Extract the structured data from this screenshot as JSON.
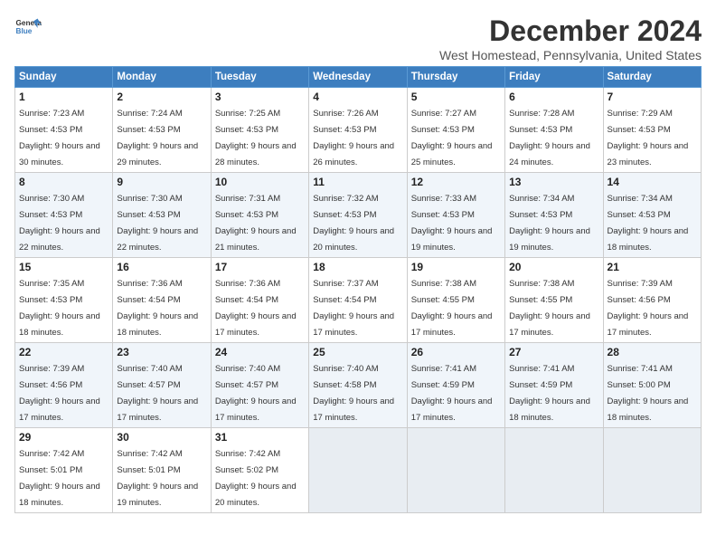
{
  "logo": {
    "line1": "General",
    "line2": "Blue"
  },
  "title": "December 2024",
  "subtitle": "West Homestead, Pennsylvania, United States",
  "headers": [
    "Sunday",
    "Monday",
    "Tuesday",
    "Wednesday",
    "Thursday",
    "Friday",
    "Saturday"
  ],
  "weeks": [
    [
      {
        "day": "1",
        "sunrise": "7:23 AM",
        "sunset": "4:53 PM",
        "daylight": "9 hours and 30 minutes."
      },
      {
        "day": "2",
        "sunrise": "7:24 AM",
        "sunset": "4:53 PM",
        "daylight": "9 hours and 29 minutes."
      },
      {
        "day": "3",
        "sunrise": "7:25 AM",
        "sunset": "4:53 PM",
        "daylight": "9 hours and 28 minutes."
      },
      {
        "day": "4",
        "sunrise": "7:26 AM",
        "sunset": "4:53 PM",
        "daylight": "9 hours and 26 minutes."
      },
      {
        "day": "5",
        "sunrise": "7:27 AM",
        "sunset": "4:53 PM",
        "daylight": "9 hours and 25 minutes."
      },
      {
        "day": "6",
        "sunrise": "7:28 AM",
        "sunset": "4:53 PM",
        "daylight": "9 hours and 24 minutes."
      },
      {
        "day": "7",
        "sunrise": "7:29 AM",
        "sunset": "4:53 PM",
        "daylight": "9 hours and 23 minutes."
      }
    ],
    [
      {
        "day": "8",
        "sunrise": "7:30 AM",
        "sunset": "4:53 PM",
        "daylight": "9 hours and 22 minutes."
      },
      {
        "day": "9",
        "sunrise": "7:30 AM",
        "sunset": "4:53 PM",
        "daylight": "9 hours and 22 minutes."
      },
      {
        "day": "10",
        "sunrise": "7:31 AM",
        "sunset": "4:53 PM",
        "daylight": "9 hours and 21 minutes."
      },
      {
        "day": "11",
        "sunrise": "7:32 AM",
        "sunset": "4:53 PM",
        "daylight": "9 hours and 20 minutes."
      },
      {
        "day": "12",
        "sunrise": "7:33 AM",
        "sunset": "4:53 PM",
        "daylight": "9 hours and 19 minutes."
      },
      {
        "day": "13",
        "sunrise": "7:34 AM",
        "sunset": "4:53 PM",
        "daylight": "9 hours and 19 minutes."
      },
      {
        "day": "14",
        "sunrise": "7:34 AM",
        "sunset": "4:53 PM",
        "daylight": "9 hours and 18 minutes."
      }
    ],
    [
      {
        "day": "15",
        "sunrise": "7:35 AM",
        "sunset": "4:53 PM",
        "daylight": "9 hours and 18 minutes."
      },
      {
        "day": "16",
        "sunrise": "7:36 AM",
        "sunset": "4:54 PM",
        "daylight": "9 hours and 18 minutes."
      },
      {
        "day": "17",
        "sunrise": "7:36 AM",
        "sunset": "4:54 PM",
        "daylight": "9 hours and 17 minutes."
      },
      {
        "day": "18",
        "sunrise": "7:37 AM",
        "sunset": "4:54 PM",
        "daylight": "9 hours and 17 minutes."
      },
      {
        "day": "19",
        "sunrise": "7:38 AM",
        "sunset": "4:55 PM",
        "daylight": "9 hours and 17 minutes."
      },
      {
        "day": "20",
        "sunrise": "7:38 AM",
        "sunset": "4:55 PM",
        "daylight": "9 hours and 17 minutes."
      },
      {
        "day": "21",
        "sunrise": "7:39 AM",
        "sunset": "4:56 PM",
        "daylight": "9 hours and 17 minutes."
      }
    ],
    [
      {
        "day": "22",
        "sunrise": "7:39 AM",
        "sunset": "4:56 PM",
        "daylight": "9 hours and 17 minutes."
      },
      {
        "day": "23",
        "sunrise": "7:40 AM",
        "sunset": "4:57 PM",
        "daylight": "9 hours and 17 minutes."
      },
      {
        "day": "24",
        "sunrise": "7:40 AM",
        "sunset": "4:57 PM",
        "daylight": "9 hours and 17 minutes."
      },
      {
        "day": "25",
        "sunrise": "7:40 AM",
        "sunset": "4:58 PM",
        "daylight": "9 hours and 17 minutes."
      },
      {
        "day": "26",
        "sunrise": "7:41 AM",
        "sunset": "4:59 PM",
        "daylight": "9 hours and 17 minutes."
      },
      {
        "day": "27",
        "sunrise": "7:41 AM",
        "sunset": "4:59 PM",
        "daylight": "9 hours and 18 minutes."
      },
      {
        "day": "28",
        "sunrise": "7:41 AM",
        "sunset": "5:00 PM",
        "daylight": "9 hours and 18 minutes."
      }
    ],
    [
      {
        "day": "29",
        "sunrise": "7:42 AM",
        "sunset": "5:01 PM",
        "daylight": "9 hours and 18 minutes."
      },
      {
        "day": "30",
        "sunrise": "7:42 AM",
        "sunset": "5:01 PM",
        "daylight": "9 hours and 19 minutes."
      },
      {
        "day": "31",
        "sunrise": "7:42 AM",
        "sunset": "5:02 PM",
        "daylight": "9 hours and 20 minutes."
      },
      null,
      null,
      null,
      null
    ]
  ]
}
